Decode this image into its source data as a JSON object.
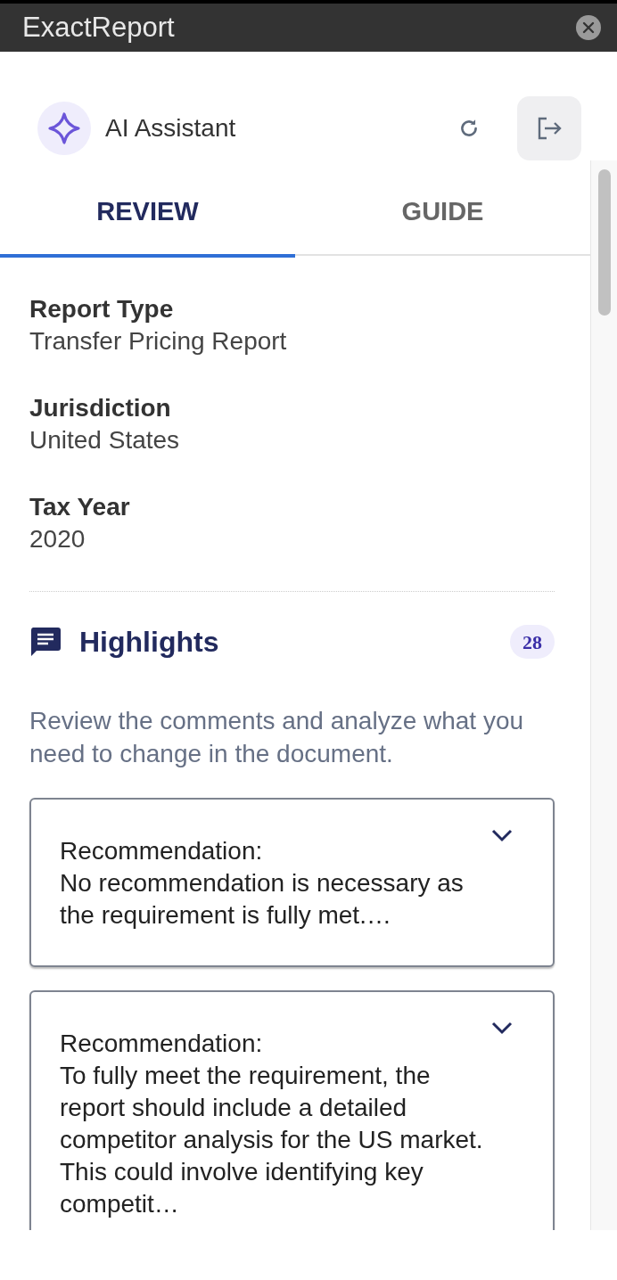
{
  "window": {
    "title": "ExactReport"
  },
  "header": {
    "title": "AI Assistant"
  },
  "tabs": [
    {
      "label": "REVIEW",
      "selected": true
    },
    {
      "label": "GUIDE",
      "selected": false
    }
  ],
  "fields": [
    {
      "label": "Report Type",
      "value": "Transfer Pricing Report"
    },
    {
      "label": "Jurisdiction",
      "value": "United States"
    },
    {
      "label": "Tax Year",
      "value": "2020"
    }
  ],
  "highlights": {
    "title": "Highlights",
    "count": "28",
    "description": "Review the comments and analyze what you need to change in the document.",
    "cards": [
      {
        "label": "Recommendation:",
        "text": "No recommendation is necessary as the requirement is fully met.…",
        "expanded": false
      },
      {
        "label": "Recommendation:",
        "text": "To fully meet the requirement, the report should include a detailed competitor analysis for the US market. This could involve identifying key competit…",
        "expanded": false
      }
    ]
  }
}
